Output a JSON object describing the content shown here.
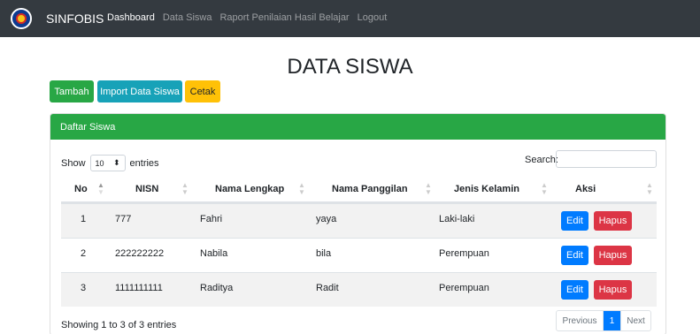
{
  "navbar": {
    "brand": "SINFOBIS",
    "links": [
      "Dashboard",
      "Data Siswa",
      "Raport Penilaian Hasil Belajar",
      "Logout"
    ]
  },
  "page": {
    "title": "DATA SISWA"
  },
  "actions": {
    "tambah": "Tambah",
    "import": "Import Data Siswa",
    "cetak": "Cetak"
  },
  "card": {
    "header": "Daftar Siswa"
  },
  "table_controls": {
    "show_label": "Show",
    "entries_value": "10",
    "entries_label": "entries",
    "search_label": "Search:"
  },
  "table": {
    "columns": [
      "No",
      "NISN",
      "Nama Lengkap",
      "Nama Panggilan",
      "Jenis Kelamin",
      "Aksi"
    ],
    "rows": [
      {
        "no": "1",
        "nisn": "777",
        "nama_lengkap": "Fahri",
        "nama_panggilan": "yaya",
        "jenis_kelamin": "Laki-laki"
      },
      {
        "no": "2",
        "nisn": "222222222",
        "nama_lengkap": "Nabila",
        "nama_panggilan": "bila",
        "jenis_kelamin": "Perempuan"
      },
      {
        "no": "3",
        "nisn": "1111111111",
        "nama_lengkap": "Raditya",
        "nama_panggilan": "Radit",
        "jenis_kelamin": "Perempuan"
      }
    ],
    "edit_label": "Edit",
    "hapus_label": "Hapus"
  },
  "footer": {
    "info": "Showing 1 to 3 of 3 entries",
    "prev": "Previous",
    "page": "1",
    "next": "Next"
  },
  "colors": {
    "navbar": "#343a40",
    "success": "#28a745",
    "info": "#17a2b8",
    "warning": "#ffc107",
    "primary": "#007bff",
    "danger": "#dc3545"
  }
}
